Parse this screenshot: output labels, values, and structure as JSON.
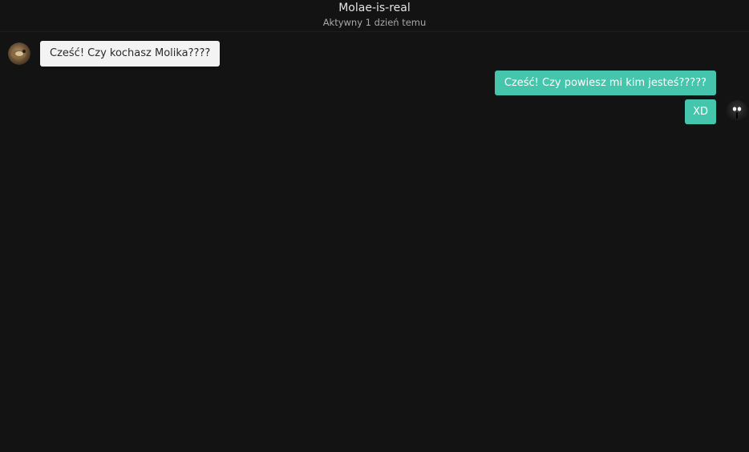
{
  "header": {
    "contact_name": "Molae-is-real",
    "status": "Aktywny 1 dzień temu"
  },
  "messages": [
    {
      "direction": "incoming",
      "text": "Cześć! Czy kochasz Molika????"
    },
    {
      "direction": "outgoing",
      "text": "Cześć! Czy powiesz mi kim jesteś?????"
    },
    {
      "direction": "outgoing",
      "text": "XD"
    }
  ],
  "colors": {
    "background": "#131313",
    "incoming_bubble": "#f3f3f3",
    "outgoing_bubble": "#45c5ab"
  }
}
